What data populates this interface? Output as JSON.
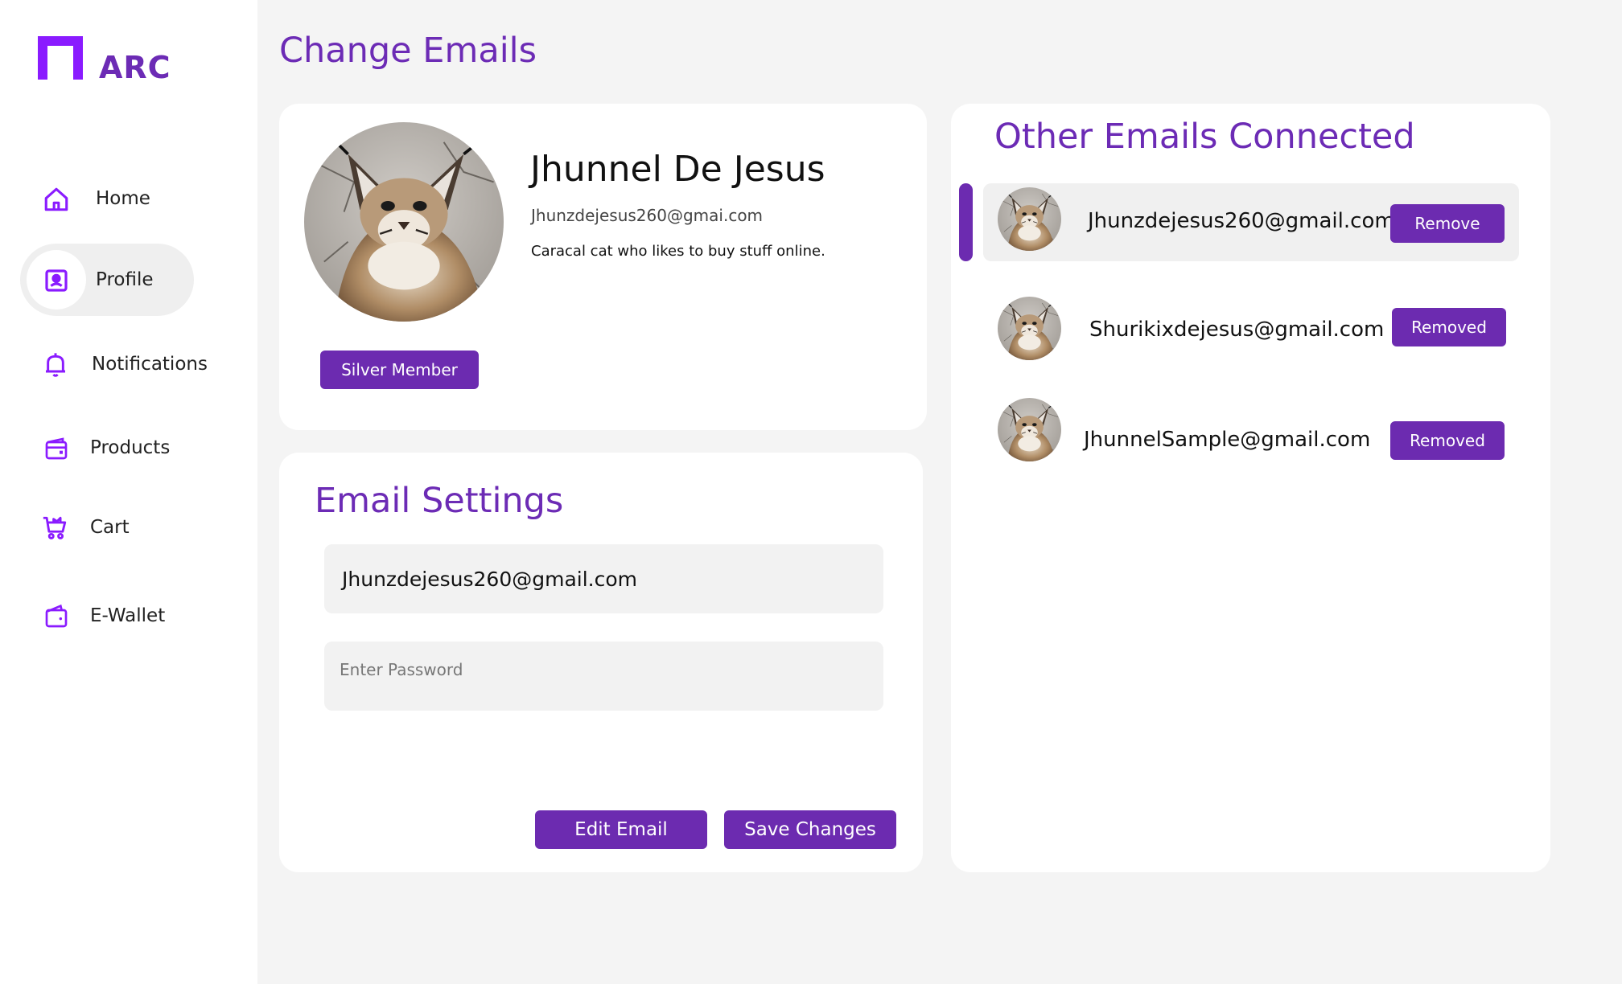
{
  "app": {
    "name": "ARC",
    "brand_color": "#6c2bb5",
    "accent_color": "#8a1bff"
  },
  "sidebar": {
    "items": [
      {
        "label": "Home",
        "icon": "home-icon",
        "active": false
      },
      {
        "label": "Profile",
        "icon": "profile-card-icon",
        "active": true
      },
      {
        "label": "Notifications",
        "icon": "bell-icon",
        "active": false
      },
      {
        "label": "Products",
        "icon": "wallet-box-icon",
        "active": false
      },
      {
        "label": "Cart",
        "icon": "cart-icon",
        "active": false
      },
      {
        "label": "E-Wallet",
        "icon": "wallet-icon",
        "active": false
      }
    ]
  },
  "page": {
    "title": "Change Emails"
  },
  "profile": {
    "name": "Jhunnel De Jesus",
    "email": "Jhunzdejesus260@gmai.com",
    "bio": "Caracal cat who likes to buy stuff online.",
    "membership": "Silver Member"
  },
  "email_settings": {
    "title": "Email Settings",
    "email_value": "Jhunzdejesus260@gmail.com",
    "password_placeholder": "Enter Password",
    "edit_label": "Edit Email",
    "save_label": "Save Changes"
  },
  "other_emails": {
    "title": "Other Emails Connected",
    "items": [
      {
        "email": "Jhunzdejesus260@gmail.com",
        "action": "Remove",
        "selected": true
      },
      {
        "email": "Shurikixdejesus@gmail.com",
        "action": "Removed",
        "selected": false
      },
      {
        "email": "JhunnelSample@gmail.com",
        "action": "Removed",
        "selected": false
      }
    ]
  }
}
